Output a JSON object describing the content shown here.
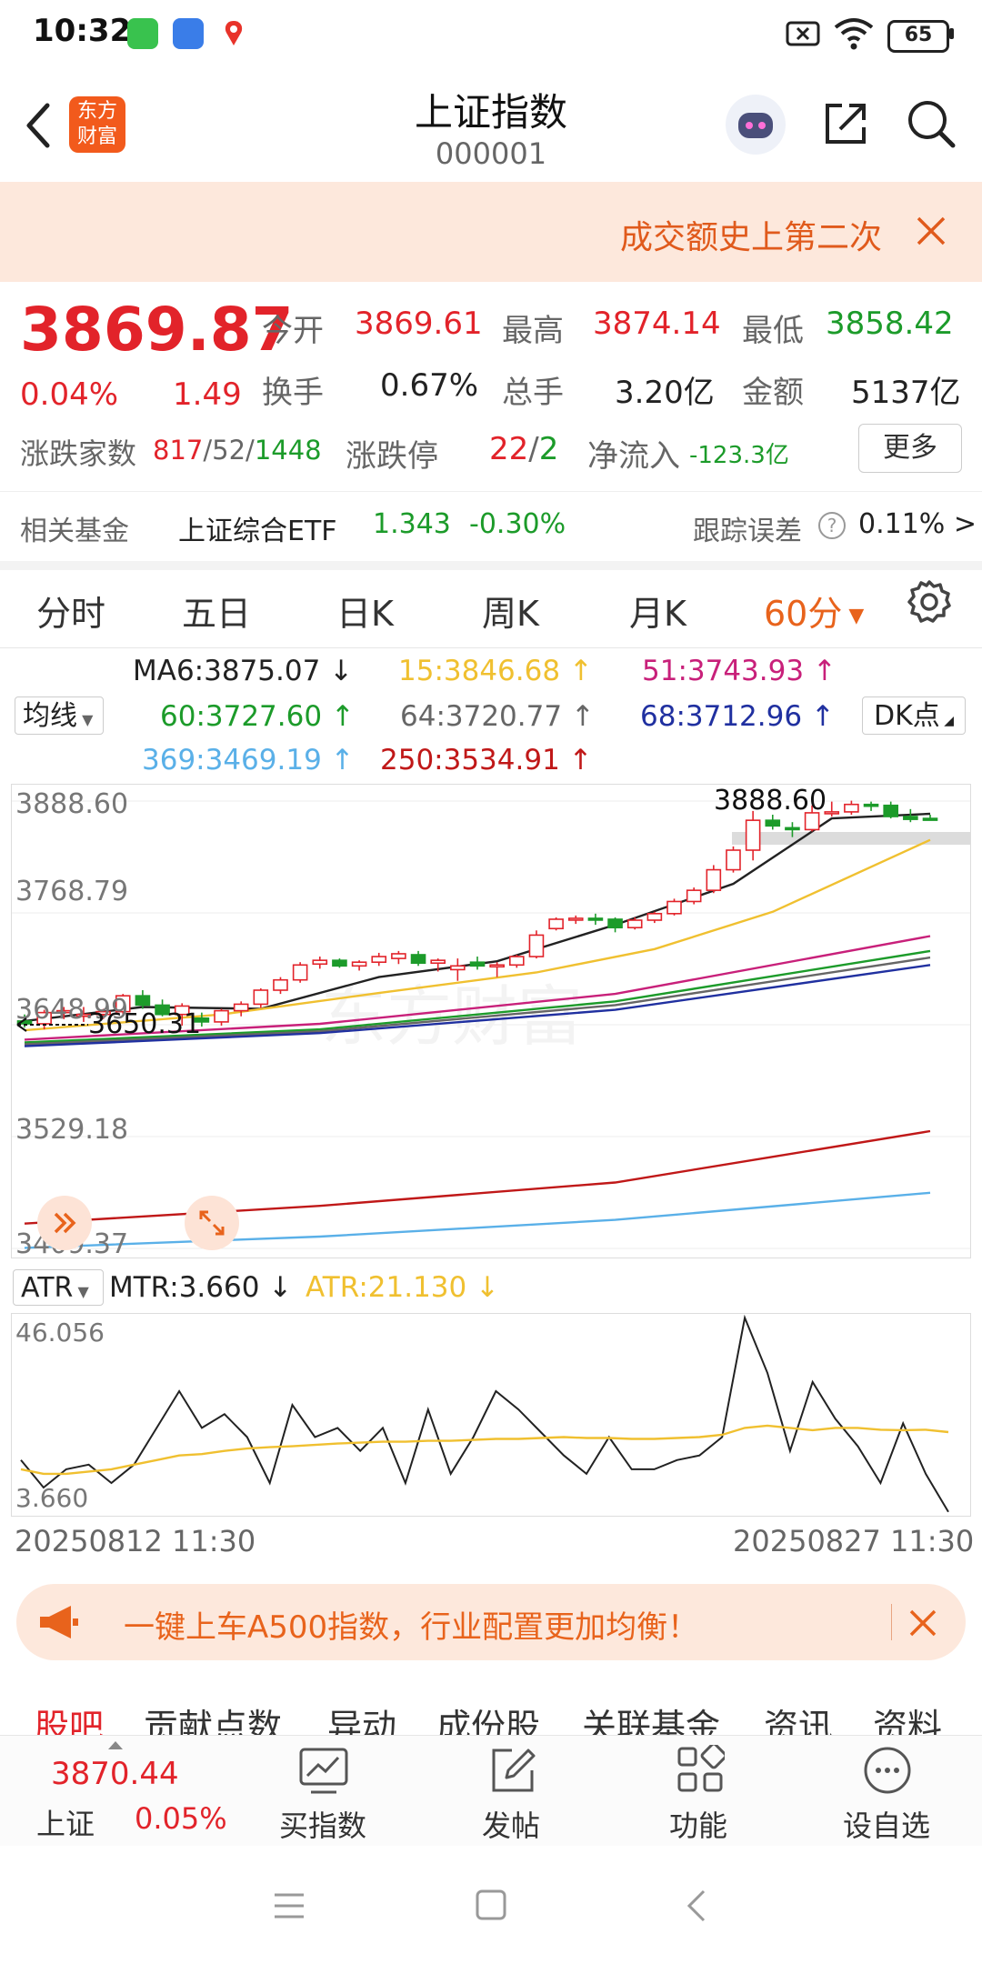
{
  "status_bar": {
    "time": "10:32",
    "battery": "65"
  },
  "header": {
    "title": "上证指数",
    "code": "000001",
    "logo_text": "东方财富"
  },
  "notice": {
    "text": "成交额史上第二次"
  },
  "quote": {
    "price": "3869.87",
    "change_pct": "0.04%",
    "change": "1.49",
    "open_label": "今开",
    "open": "3869.61",
    "high_label": "最高",
    "high": "3874.14",
    "low_label": "最低",
    "low": "3858.42",
    "turnover_label": "换手",
    "turnover": "0.67%",
    "volume_label": "总手",
    "volume": "3.20亿",
    "amount_label": "金额",
    "amount": "5137亿",
    "breadth_label": "涨跌家数",
    "up": "817",
    "flat": "52",
    "down": "1448",
    "limit_label": "涨跌停",
    "limit_up": "22",
    "limit_down": "2",
    "netflow_label": "净流入",
    "netflow": "-123.3亿",
    "more_label": "更多"
  },
  "fund": {
    "label": "相关基金",
    "name": "上证综合ETF",
    "price": "1.343",
    "change": "-0.30%",
    "track_label": "跟踪误差",
    "track": "0.11% >"
  },
  "periods": {
    "items": [
      "分时",
      "五日",
      "日K",
      "周K",
      "月K"
    ],
    "active": "60分"
  },
  "ma": {
    "selector": "均线",
    "dk": "DK点",
    "items": [
      {
        "label": "MA6:3875.07",
        "arrow": "↓",
        "color": "#222222"
      },
      {
        "label": "15:3846.68",
        "arrow": "↑",
        "color": "#f0c030"
      },
      {
        "label": "51:3743.93",
        "arrow": "↑",
        "color": "#c8207a"
      },
      {
        "label": "60:3727.60",
        "arrow": "↑",
        "color": "#1c9b2a"
      },
      {
        "label": "64:3720.77",
        "arrow": "↑",
        "color": "#666666"
      },
      {
        "label": "68:3712.96",
        "arrow": "↑",
        "color": "#2030a0"
      },
      {
        "label": "369:3469.19",
        "arrow": "↑",
        "color": "#5ab0e8"
      },
      {
        "label": "250:3534.91",
        "arrow": "↑",
        "color": "#c01818"
      }
    ]
  },
  "chart_data": {
    "type": "candlestick",
    "yaxis_labels": [
      "3888.60",
      "3768.79",
      "3648.99",
      "3529.18",
      "3409.37"
    ],
    "ylim": [
      3409.37,
      3888.6
    ],
    "high_marker": "3888.60",
    "low_marker": "3650.31",
    "x_start": "20250812 11:30",
    "x_end": "20250827 11:30",
    "candles": [
      [
        3653,
        3660,
        3646,
        3650
      ],
      [
        3650,
        3665,
        3644,
        3662
      ],
      [
        3662,
        3668,
        3655,
        3664
      ],
      [
        3658,
        3668,
        3652,
        3660
      ],
      [
        3660,
        3666,
        3655,
        3663
      ],
      [
        3663,
        3682,
        3660,
        3680
      ],
      [
        3680,
        3686,
        3666,
        3670
      ],
      [
        3670,
        3676,
        3658,
        3660
      ],
      [
        3660,
        3672,
        3648,
        3669
      ],
      [
        3656,
        3662,
        3647,
        3652
      ],
      [
        3652,
        3666,
        3648,
        3664
      ],
      [
        3664,
        3674,
        3658,
        3671
      ],
      [
        3671,
        3688,
        3667,
        3686
      ],
      [
        3686,
        3700,
        3682,
        3697
      ],
      [
        3697,
        3716,
        3694,
        3713
      ],
      [
        3714,
        3722,
        3709,
        3718
      ],
      [
        3718,
        3720,
        3710,
        3712
      ],
      [
        3712,
        3718,
        3707,
        3716
      ],
      [
        3716,
        3726,
        3712,
        3722
      ],
      [
        3720,
        3728,
        3714,
        3725
      ],
      [
        3724,
        3728,
        3712,
        3715
      ],
      [
        3715,
        3720,
        3706,
        3718
      ],
      [
        3708,
        3720,
        3696,
        3712
      ],
      [
        3716,
        3722,
        3708,
        3712
      ],
      [
        3712,
        3716,
        3700,
        3713
      ],
      [
        3713,
        3724,
        3710,
        3722
      ],
      [
        3722,
        3750,
        3720,
        3745
      ],
      [
        3752,
        3764,
        3750,
        3762
      ],
      [
        3762,
        3766,
        3757,
        3763
      ],
      [
        3763,
        3768,
        3756,
        3762
      ],
      [
        3762,
        3764,
        3748,
        3753
      ],
      [
        3753,
        3764,
        3751,
        3761
      ],
      [
        3761,
        3770,
        3758,
        3768
      ],
      [
        3768,
        3784,
        3766,
        3781
      ],
      [
        3781,
        3796,
        3778,
        3793
      ],
      [
        3793,
        3820,
        3790,
        3815
      ],
      [
        3815,
        3840,
        3812,
        3836
      ],
      [
        3836,
        3878,
        3825,
        3868
      ],
      [
        3868,
        3874,
        3858,
        3862
      ],
      [
        3860,
        3866,
        3850,
        3858
      ],
      [
        3858,
        3884,
        3856,
        3876
      ],
      [
        3876,
        3888,
        3872,
        3877
      ],
      [
        3877,
        3889,
        3874,
        3885
      ],
      [
        3885,
        3888,
        3878,
        3884
      ],
      [
        3884,
        3888,
        3870,
        3872
      ],
      [
        3872,
        3880,
        3866,
        3869
      ],
      [
        3870,
        3874,
        3868,
        3869
      ]
    ],
    "ma_lines": [
      {
        "name": "MA6",
        "color": "#222222",
        "points": [
          [
            0,
            3653
          ],
          [
            6,
            3668
          ],
          [
            12,
            3666
          ],
          [
            18,
            3700
          ],
          [
            24,
            3717
          ],
          [
            30,
            3756
          ],
          [
            36,
            3800
          ],
          [
            41,
            3870
          ],
          [
            46,
            3875
          ]
        ]
      },
      {
        "name": "15",
        "color": "#f0c030",
        "points": [
          [
            0,
            3643
          ],
          [
            10,
            3660
          ],
          [
            18,
            3683
          ],
          [
            26,
            3705
          ],
          [
            32,
            3730
          ],
          [
            38,
            3770
          ],
          [
            46,
            3847
          ]
        ]
      },
      {
        "name": "51",
        "color": "#c8207a",
        "points": [
          [
            0,
            3633
          ],
          [
            15,
            3650
          ],
          [
            30,
            3682
          ],
          [
            46,
            3744
          ]
        ]
      },
      {
        "name": "60",
        "color": "#1c9b2a",
        "points": [
          [
            0,
            3630
          ],
          [
            15,
            3644
          ],
          [
            30,
            3674
          ],
          [
            46,
            3728
          ]
        ]
      },
      {
        "name": "64",
        "color": "#666666",
        "points": [
          [
            0,
            3628
          ],
          [
            15,
            3642
          ],
          [
            30,
            3670
          ],
          [
            46,
            3721
          ]
        ]
      },
      {
        "name": "68",
        "color": "#2030a0",
        "points": [
          [
            0,
            3626
          ],
          [
            15,
            3640
          ],
          [
            30,
            3665
          ],
          [
            46,
            3713
          ]
        ]
      },
      {
        "name": "250",
        "color": "#c01818",
        "points": [
          [
            0,
            3436
          ],
          [
            15,
            3455
          ],
          [
            30,
            3480
          ],
          [
            46,
            3535
          ]
        ]
      },
      {
        "name": "369",
        "color": "#5ab0e8",
        "points": [
          [
            0,
            3410
          ],
          [
            15,
            3422
          ],
          [
            30,
            3440
          ],
          [
            46,
            3469
          ]
        ]
      }
    ]
  },
  "atr": {
    "selector": "ATR",
    "mtr_label": "MTR:3.660",
    "mtr_arrow": "↓",
    "atr_label": "ATR:21.130",
    "atr_arrow": "↓",
    "ymax_label": "46.056",
    "ymin_label": "3.660",
    "ylim": [
      3.66,
      46.056
    ],
    "mtr": [
      15,
      9,
      13,
      14,
      10,
      14,
      22,
      30,
      22,
      25,
      20,
      10,
      27,
      20,
      22,
      17,
      22,
      10,
      26,
      12,
      20,
      30,
      26,
      21,
      16,
      12,
      20,
      13,
      13,
      15,
      16,
      20,
      46,
      34,
      17,
      32,
      24,
      18,
      10,
      23,
      12,
      3.7
    ],
    "atr_line": [
      13,
      12,
      12,
      12.5,
      13,
      14,
      15,
      16,
      16.3,
      17,
      17.5,
      17.8,
      18,
      18.3,
      18.6,
      18.8,
      19,
      19,
      19.2,
      19.2,
      19.4,
      19.6,
      19.6,
      19.8,
      20,
      19.8,
      19.8,
      19.6,
      19.6,
      19.8,
      20,
      20.5,
      22,
      22.5,
      22,
      21.5,
      22,
      22,
      21.6,
      21.5,
      21.6,
      21.1
    ]
  },
  "ad": {
    "text": "一键上车A500指数，行业配置更加均衡！"
  },
  "bottom_tabs": [
    "股吧",
    "贡献点数",
    "异动",
    "成份股",
    "关联基金",
    "资讯",
    "资料"
  ],
  "bottom_bar": {
    "index_price": "3870.44",
    "index_name": "上证",
    "index_change": "0.05%",
    "items": [
      {
        "label": "买指数",
        "icon": "chart-board-icon"
      },
      {
        "label": "发帖",
        "icon": "edit-icon"
      },
      {
        "label": "功能",
        "icon": "apps-grid-icon"
      },
      {
        "label": "设自选",
        "icon": "more-circle-icon"
      }
    ]
  },
  "watermark": "东方财富"
}
